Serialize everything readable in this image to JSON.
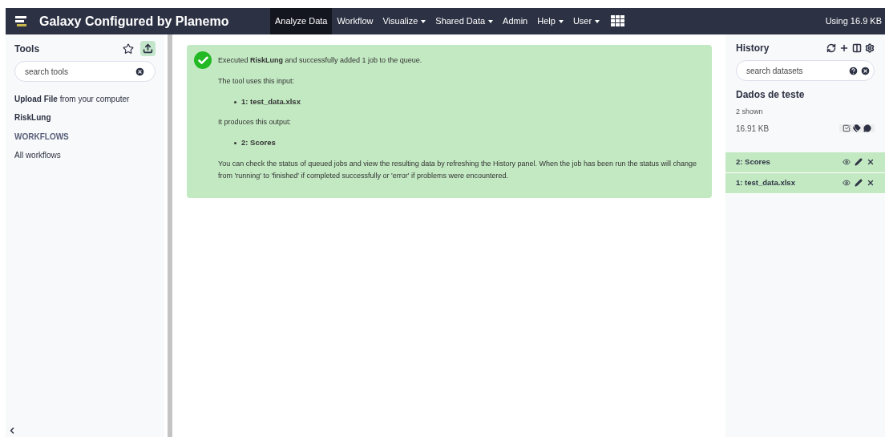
{
  "brand": "Galaxy Configured by Planemo",
  "nav": [
    {
      "label": "Analyze Data",
      "selected": true,
      "dropdown": false
    },
    {
      "label": "Workflow",
      "selected": false,
      "dropdown": false
    },
    {
      "label": "Visualize",
      "selected": false,
      "dropdown": true
    },
    {
      "label": "Shared Data",
      "selected": false,
      "dropdown": true
    },
    {
      "label": "Admin",
      "selected": false,
      "dropdown": false
    },
    {
      "label": "Help",
      "selected": false,
      "dropdown": true
    },
    {
      "label": "User",
      "selected": false,
      "dropdown": true
    }
  ],
  "quota": "Using 16.9 KB",
  "tools": {
    "title": "Tools",
    "search_placeholder": "search tools",
    "upload": "**Upload File** from your computer",
    "items": [
      {
        "kind": "tool",
        "label": "RiskLung"
      },
      {
        "kind": "section",
        "label": "WORKFLOWS"
      },
      {
        "kind": "link",
        "label": "All workflows"
      }
    ]
  },
  "message": {
    "lines": [
      {
        "kind": "para",
        "text": "Executed **RiskLung** and successfully added 1 job to the queue."
      },
      {
        "kind": "para",
        "text": "The tool uses this input:"
      },
      {
        "kind": "bullet",
        "text": "1: test_data.xlsx"
      },
      {
        "kind": "para",
        "text": "It produces this output:"
      },
      {
        "kind": "bullet",
        "text": "2: Scores"
      },
      {
        "kind": "para",
        "text": "You can check the status of queued jobs and view the resulting data by refreshing the History panel. When the job has been run the status will change from 'running' to 'finished' if completed successfully or 'error' if problems were encountered."
      }
    ]
  },
  "history": {
    "title": "History",
    "search_placeholder": "search datasets",
    "name": "Dados de teste",
    "shown": "2 shown",
    "size": "16.91 KB",
    "datasets": [
      {
        "label": "2: Scores"
      },
      {
        "label": "1: test_data.xlsx"
      }
    ]
  }
}
